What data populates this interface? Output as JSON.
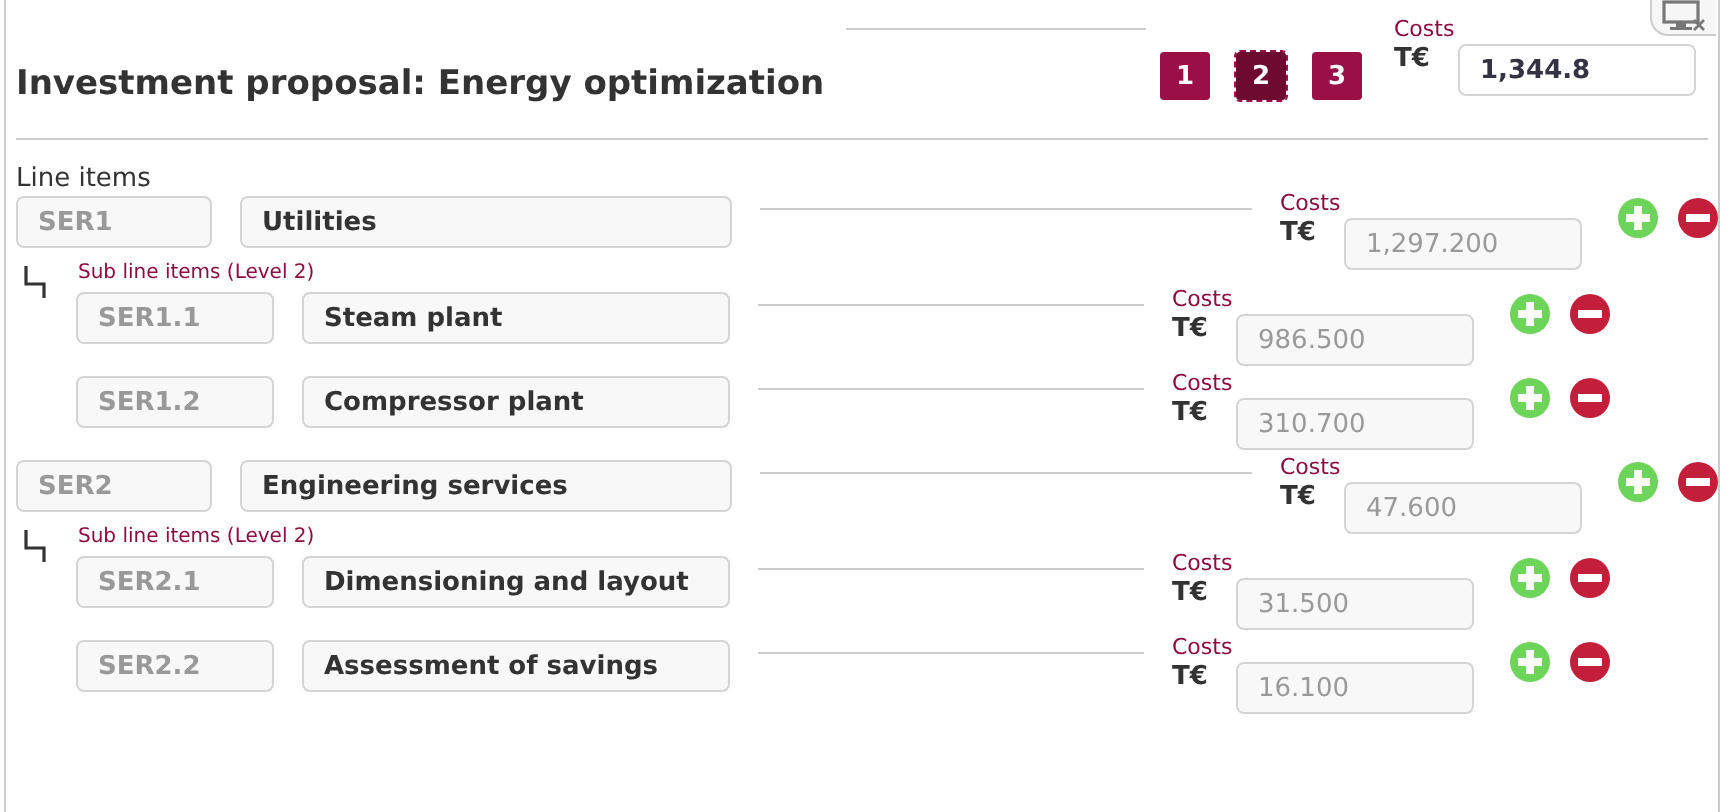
{
  "header": {
    "title": "Investment proposal: Energy optimization",
    "pages": [
      {
        "label": "1",
        "selected": false
      },
      {
        "label": "2",
        "selected": true
      },
      {
        "label": "3",
        "selected": false
      }
    ],
    "total": {
      "label": "Costs",
      "unit": "T€",
      "value": "1,344.8"
    }
  },
  "section_title": "Line items",
  "items": [
    {
      "code": "SER1",
      "name": "Utilities",
      "costs_label": "Costs",
      "unit": "T€",
      "cost": "1,297.200",
      "sub_heading": "Sub line items (Level 2)",
      "children": [
        {
          "code": "SER1.1",
          "name": "Steam plant",
          "costs_label": "Costs",
          "unit": "T€",
          "cost": "986.500"
        },
        {
          "code": "SER1.2",
          "name": "Compressor plant",
          "costs_label": "Costs",
          "unit": "T€",
          "cost": "310.700"
        }
      ]
    },
    {
      "code": "SER2",
      "name": "Engineering services",
      "costs_label": "Costs",
      "unit": "T€",
      "cost": "47.600",
      "sub_heading": "Sub line items (Level 2)",
      "children": [
        {
          "code": "SER2.1",
          "name": "Dimensioning and layout",
          "costs_label": "Costs",
          "unit": "T€",
          "cost": "31.500"
        },
        {
          "code": "SER2.2",
          "name": "Assessment of savings",
          "costs_label": "Costs",
          "unit": "T€",
          "cost": "16.100"
        }
      ]
    }
  ]
}
